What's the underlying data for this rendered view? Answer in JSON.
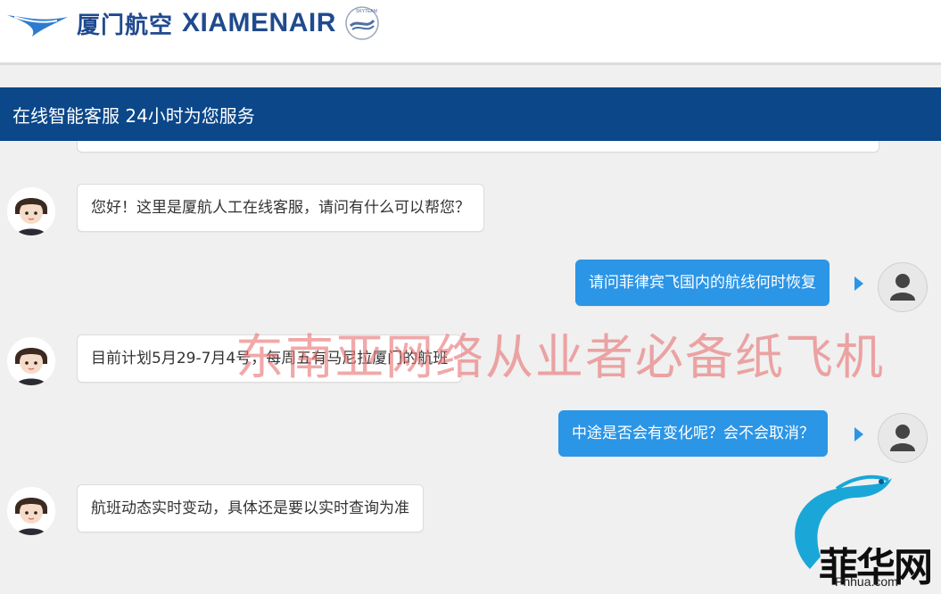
{
  "brand": {
    "name_cn": "厦门航空",
    "name_en": "XIAMENAIR",
    "alliance": "SKYTEAM"
  },
  "header": {
    "title": "在线智能客服 24小时为您服务"
  },
  "chat": {
    "partial_message": "",
    "messages": [
      {
        "sender": "agent",
        "text": "您好！这里是厦航人工在线客服，请问有什么可以帮您？"
      },
      {
        "sender": "user",
        "text": "请问菲律宾飞国内的航线何时恢复"
      },
      {
        "sender": "agent",
        "text": "目前计划5月29-7月4号，每周五有马尼拉厦门的航班"
      },
      {
        "sender": "user",
        "text": "中途是否会有变化呢？会不会取消？"
      },
      {
        "sender": "agent",
        "text": "航班动态实时变动，具体还是要以实时查询为准"
      }
    ]
  },
  "overlay": {
    "watermark": "东南亚网络从业者必备纸飞机",
    "site_cn": "菲华网",
    "site_url": "Phhua.com"
  },
  "colors": {
    "header_bg": "#0b4789",
    "user_bubble": "#2b95e6",
    "brand": "#1f4a8e"
  }
}
